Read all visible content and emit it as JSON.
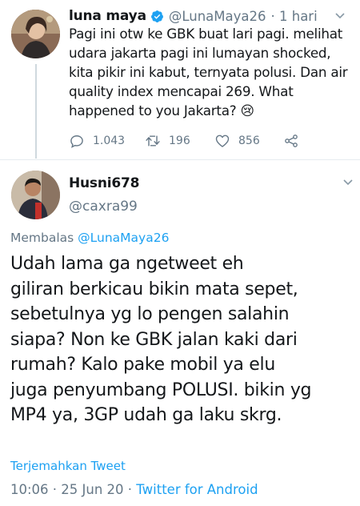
{
  "parent_tweet": {
    "name": "luna maya",
    "handle": "@LunaMaya26",
    "time": "· 1 hari",
    "text_lines": [
      "Pagi ini otw ke GBK buat lari pagi. melihat",
      "udara jakarta pagi ini lumayan shocked,",
      "kita pikir ini kabut, ternyata polusi. Dan air",
      "quality index mencapai 269. What",
      "happened to you Jakarta? 😢"
    ],
    "replies": "1.043",
    "retweets": "196",
    "likes": "856",
    "colors": {
      "verified": "#1da1f2",
      "secondary": "#657786"
    }
  },
  "reply_tweet": {
    "name": "Husni678",
    "handle": "@caxra99",
    "replying_prefix": "Membalas",
    "replying_to": "@LunaMaya26",
    "text_lines": [
      "Udah lama ga ngetweet eh",
      "giliran berkicau bikin mata sepet,",
      "sebetulnya yg lo pengen salahin",
      "siapa? Non ke GBK jalan kaki dari",
      "rumah? Kalo pake mobil ya elu",
      "juga penyumbang POLUSI. bikin yg",
      "MP4 ya, 3GP udah ga laku skrg."
    ],
    "translate_label": "Terjemahkan Tweet",
    "timestamp": "10:06 · 25 Jun 20 · ",
    "client": "Twitter for Android",
    "colors": {
      "link": "#1da1f2"
    }
  }
}
